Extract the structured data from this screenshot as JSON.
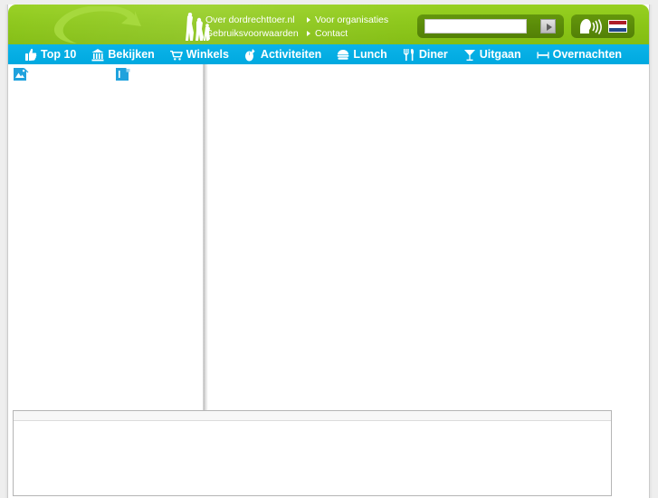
{
  "site": {
    "name": "dordrechttoer.nl",
    "logo_icon": "circular-arrow-swoosh-logo",
    "background_color": "#eeeeee",
    "page_background": "#ffffff"
  },
  "header": {
    "green_color": "#8cc81a",
    "pod_color": "#5b8c0a",
    "people_icon": "two-people-icon",
    "links": [
      {
        "label": "Over dordrechttoer.nl",
        "icon": "none"
      },
      {
        "label": "Voor organisaties",
        "icon": "arrow-right-icon"
      },
      {
        "label": "Gebruiksvoorwaarden",
        "icon": "none"
      },
      {
        "label": "Contact",
        "icon": "arrow-right-icon"
      }
    ],
    "search": {
      "value": "",
      "placeholder": "",
      "go_button_icon": "play-arrow-icon",
      "go_button_label": ""
    },
    "language": {
      "speech_icon": "read-aloud-speech-icon",
      "flag_icon": "dutch-flag-icon",
      "flag_label": "Nederlands",
      "flag_colors": [
        "#ae1c28",
        "#ffffff",
        "#21468b"
      ]
    }
  },
  "nav": {
    "background_color": "#00aee5",
    "items": [
      {
        "label": "Top 10",
        "icon": "thumbs-up-icon"
      },
      {
        "label": "Bekijken",
        "icon": "museum-building-icon"
      },
      {
        "label": "Winkels",
        "icon": "shopping-cart-icon"
      },
      {
        "label": "Activiteiten",
        "icon": "mouse-pointer-icon"
      },
      {
        "label": "Lunch",
        "icon": "sandwich-icon"
      },
      {
        "label": "Diner",
        "icon": "fork-knife-icon"
      },
      {
        "label": "Uitgaan",
        "icon": "cocktail-glass-icon"
      },
      {
        "label": "Overnachten",
        "icon": "bed-icon"
      }
    ]
  },
  "content": {
    "broken_images": [
      {
        "icon": "broken-image-icon",
        "alt": ""
      },
      {
        "icon": "broken-image-icon",
        "alt": ""
      }
    ],
    "left_column_text": "",
    "right_column_text": ""
  },
  "bottom_panel": {
    "title": "",
    "body_text": ""
  }
}
